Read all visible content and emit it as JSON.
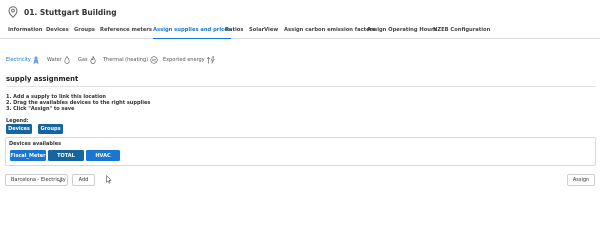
{
  "header": {
    "title": "01. Stuttgart Building",
    "icon": "map-pin-icon"
  },
  "tabs": [
    {
      "label": "Information",
      "active": false
    },
    {
      "label": "Devices",
      "active": false
    },
    {
      "label": "Groups",
      "active": false
    },
    {
      "label": "Reference meters",
      "active": false
    },
    {
      "label": "Assign supplies and prices",
      "active": true
    },
    {
      "label": "Ratios",
      "active": false
    },
    {
      "label": "SolarView",
      "active": false
    },
    {
      "label": "Assign carbon emission factors",
      "active": false
    },
    {
      "label": "Assign Operating Hours",
      "active": false
    },
    {
      "label": "NZEB Configuration",
      "active": false
    }
  ],
  "utilities": [
    {
      "label": "Electricity",
      "icon": "electricity-tower-icon",
      "active": true
    },
    {
      "label": "Water",
      "icon": "water-drop-icon",
      "active": false
    },
    {
      "label": "Gas",
      "icon": "flame-icon",
      "active": false
    },
    {
      "label": "Thermal (heating)",
      "icon": "thermal-icon",
      "active": false
    },
    {
      "label": "Exported energy",
      "icon": "exported-energy-icon",
      "active": false
    }
  ],
  "section": {
    "title": "supply assignment",
    "instructions": [
      "1. Add a supply to link this location",
      "2. Drag the availables devices to the right supplies",
      "3. Click \"Assign\" to save"
    ]
  },
  "legend": {
    "label": "Legend:",
    "items": [
      "Devices",
      "Groups"
    ]
  },
  "devices_available": {
    "label": "Devices availables",
    "items": [
      {
        "label": "Fiscal_Meter",
        "kind": "device"
      },
      {
        "label": "TOTAL",
        "kind": "group"
      },
      {
        "label": "HVAC",
        "kind": "device"
      }
    ]
  },
  "controls": {
    "supply_select": "Barcelona - Electricity",
    "add_label": "Add",
    "assign_label": "Assign"
  },
  "colors": {
    "accent": "#1976d2",
    "device_chip": "#1976d2",
    "group_chip": "#1565a0"
  }
}
